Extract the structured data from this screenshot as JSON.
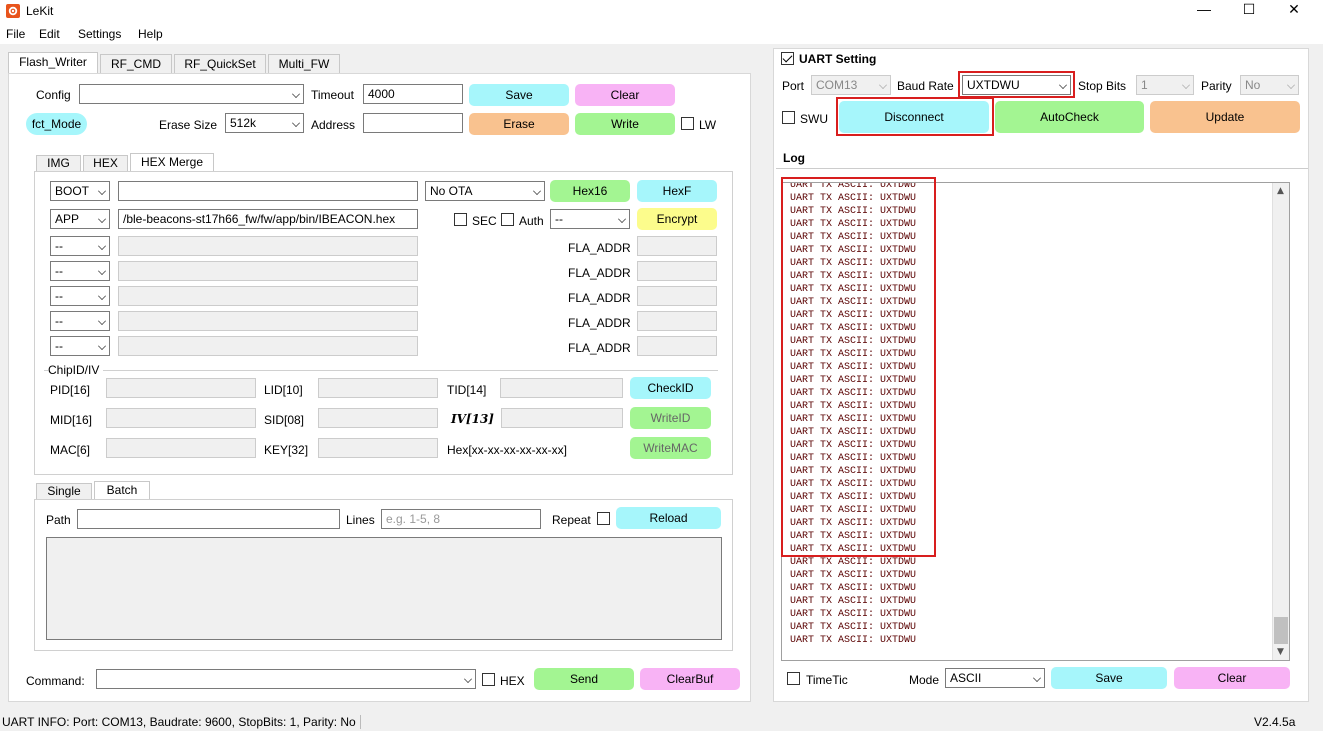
{
  "window": {
    "title": "LeKit",
    "minimize": "—",
    "maximize": "☐",
    "close": "✕"
  },
  "menu": [
    "File",
    "Edit",
    "Settings",
    "Help"
  ],
  "tabs": [
    "Flash_Writer",
    "RF_CMD",
    "RF_QuickSet",
    "Multi_FW"
  ],
  "flash": {
    "config_label": "Config",
    "config_value": "",
    "timeout_label": "Timeout",
    "timeout_value": "4000",
    "save": "Save",
    "clear": "Clear",
    "fct_mode": "fct_Mode",
    "erase_size_label": "Erase Size",
    "erase_size_value": "512k",
    "address_label": "Address",
    "address_value": "",
    "erase": "Erase",
    "write": "Write",
    "lw": "LW"
  },
  "subtabs": [
    "IMG",
    "HEX",
    "HEX Merge"
  ],
  "merge": {
    "boot_sel": "BOOT",
    "boot_path": "",
    "ota_sel": "No OTA",
    "hex16": "Hex16",
    "hexf": "HexF",
    "app_sel": "APP",
    "app_path": "/ble-beacons-st17h66_fw/fw/app/bin/IBEACON.hex",
    "sec": "SEC",
    "auth": "Auth",
    "auth_sel": "--",
    "encrypt": "Encrypt",
    "rows": [
      {
        "sel": "--",
        "fla": "FLA_ADDR"
      },
      {
        "sel": "--",
        "fla": "FLA_ADDR"
      },
      {
        "sel": "--",
        "fla": "FLA_ADDR"
      },
      {
        "sel": "--",
        "fla": "FLA_ADDR"
      },
      {
        "sel": "--",
        "fla": "FLA_ADDR"
      }
    ]
  },
  "chip": {
    "title": "ChipID/IV",
    "pid": "PID[16]",
    "lid": "LID[10]",
    "tid": "TID[14]",
    "checkid": "CheckID",
    "mid": "MID[16]",
    "sid": "SID[08]",
    "iv": "IV[13]",
    "writeid": "WriteID",
    "mac": "MAC[6]",
    "key": "KEY[32]",
    "hexfmt": "Hex[xx-xx-xx-xx-xx-xx]",
    "writemac": "WriteMAC"
  },
  "batch": {
    "tabs": [
      "Single",
      "Batch"
    ],
    "path_label": "Path",
    "path_value": "",
    "lines_label": "Lines",
    "lines_placeholder": "e.g. 1-5, 8",
    "repeat": "Repeat",
    "reload": "Reload"
  },
  "command": {
    "label": "Command:",
    "value": "",
    "hex": "HEX",
    "send": "Send",
    "clearbuf": "ClearBuf"
  },
  "uart": {
    "title": "UART Setting",
    "port_label": "Port",
    "port_value": "COM13",
    "baud_label": "Baud Rate",
    "baud_value": "UXTDWU",
    "stop_label": "Stop Bits",
    "stop_value": "1",
    "parity_label": "Parity",
    "parity_value": "No",
    "swu": "SWU",
    "disconnect": "Disconnect",
    "autocheck": "AutoCheck",
    "update": "Update"
  },
  "log": {
    "title": "Log",
    "lines": [
      "UART TX ASCII: UXTDWU",
      "UART TX ASCII: UXTDWU",
      "UART TX ASCII: UXTDWU",
      "UART TX ASCII: UXTDWU",
      "UART TX ASCII: UXTDWU",
      "UART TX ASCII: UXTDWU",
      "UART TX ASCII: UXTDWU",
      "UART TX ASCII: UXTDWU",
      "UART TX ASCII: UXTDWU",
      "UART TX ASCII: UXTDWU",
      "UART TX ASCII: UXTDWU",
      "UART TX ASCII: UXTDWU",
      "UART TX ASCII: UXTDWU",
      "UART TX ASCII: UXTDWU",
      "UART TX ASCII: UXTDWU",
      "UART TX ASCII: UXTDWU",
      "UART TX ASCII: UXTDWU",
      "UART TX ASCII: UXTDWU",
      "UART TX ASCII: UXTDWU",
      "UART TX ASCII: UXTDWU",
      "UART TX ASCII: UXTDWU",
      "UART TX ASCII: UXTDWU",
      "UART TX ASCII: UXTDWU",
      "UART TX ASCII: UXTDWU",
      "UART TX ASCII: UXTDWU",
      "UART TX ASCII: UXTDWU",
      "UART TX ASCII: UXTDWU",
      "UART TX ASCII: UXTDWU",
      "UART TX ASCII: UXTDWU",
      "UART TX ASCII: UXTDWU",
      "UART TX ASCII: UXTDWU",
      "UART TX ASCII: UXTDWU",
      "UART TX ASCII: UXTDWU",
      "UART TX ASCII: UXTDWU",
      "UART TX ASCII: UXTDWU",
      "UART TX ASCII: UXTDWU"
    ],
    "timetic": "TimeTic",
    "mode_label": "Mode",
    "mode_value": "ASCII",
    "save": "Save",
    "clear": "Clear"
  },
  "status": {
    "info": "UART INFO:  Port: COM13, Baudrate: 9600, StopBits: 1, Parity: No",
    "version": "V2.4.5a"
  }
}
